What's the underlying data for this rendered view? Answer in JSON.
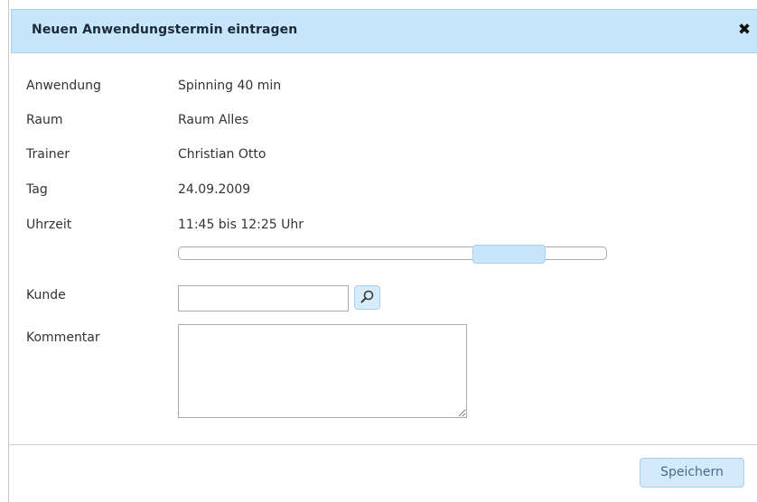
{
  "dialog": {
    "title": "Neuen Anwendungstermin eintragen",
    "close_icon": "close-icon"
  },
  "details": {
    "anwendung_label": "Anwendung",
    "anwendung_value": "Spinning 40 min",
    "raum_label": "Raum",
    "raum_value": "Raum Alles",
    "trainer_label": "Trainer",
    "trainer_value": "Christian Otto",
    "tag_label": "Tag",
    "tag_value": "24.09.2009",
    "uhrzeit_label": "Uhrzeit",
    "uhrzeit_value": "11:45 bis 12:25 Uhr"
  },
  "time_slider": {
    "range_start_fraction": 0.685,
    "range_end_fraction": 0.855
  },
  "form": {
    "kunde_label": "Kunde",
    "kunde_value": "",
    "search_icon": "search-icon",
    "kommentar_label": "Kommentar",
    "kommentar_value": ""
  },
  "footer": {
    "save_label": "Speichern"
  },
  "colors": {
    "header_bg": "#c7e6fb",
    "accent": "#a8d1ee",
    "button_text": "#4b6a85"
  }
}
